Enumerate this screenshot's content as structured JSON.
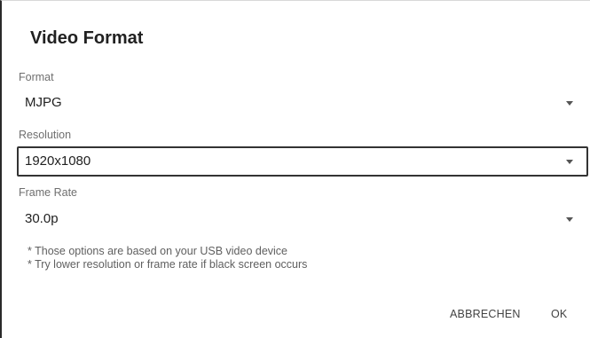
{
  "dialog": {
    "title": "Video Format",
    "fields": [
      {
        "label": "Format",
        "value": "MJPG"
      },
      {
        "label": "Resolution",
        "value": "1920x1080"
      },
      {
        "label": "Frame Rate",
        "value": "30.0p"
      }
    ],
    "notes": [
      "* Those options are based on your USB video device",
      "* Try lower resolution or frame rate if black screen occurs"
    ],
    "buttons": {
      "cancel": "ABBRECHEN",
      "ok": "OK"
    }
  },
  "icons": {
    "dropdown": "triangle-down-icon"
  },
  "colors": {
    "focused_border": "#333333",
    "label": "#6f6f6f",
    "text": "#212121"
  }
}
